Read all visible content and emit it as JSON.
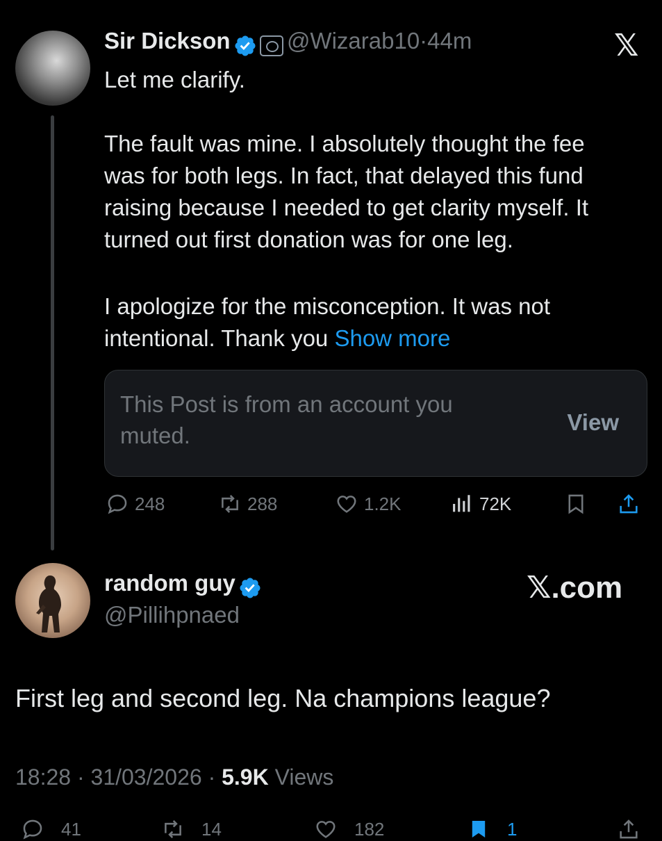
{
  "tweet1": {
    "name": "Sir Dickson",
    "handle": "@Wizarab10",
    "separator": "·",
    "time": "44m",
    "lines": [
      "Let me clarify.",
      "The fault was mine. I absolutely thought the fee",
      "was for both legs. In fact, that delayed this fund",
      "raising because I needed to get clarity myself. It",
      "turned out first donation was for one leg.",
      "I apologize for the misconception. It was not",
      "intentional. Thank you"
    ],
    "show_more": "Show more",
    "muted_notice": "This Post is from an account you muted.",
    "view_label": "View",
    "stats": {
      "replies": "248",
      "reposts": "288",
      "likes": "1.2K",
      "views": "72K"
    }
  },
  "brand": {
    "x_mark": "𝕏",
    "x_com": "𝕏.com"
  },
  "tweet2": {
    "name": "random guy",
    "handle": "@Pillihpnaed",
    "text": "First leg and second leg. Na champions league?",
    "time": "18:28",
    "date": "31/03/2026",
    "views_count": "5.9K",
    "views_label": "Views",
    "stats": {
      "replies": "41",
      "reposts": "14",
      "likes": "182",
      "bookmarks": "1"
    }
  },
  "colors": {
    "background": "#000000",
    "text": "#e7e9ea",
    "secondary": "#71767b",
    "link": "#1d9bf0",
    "verified": "#1d9bf0"
  }
}
